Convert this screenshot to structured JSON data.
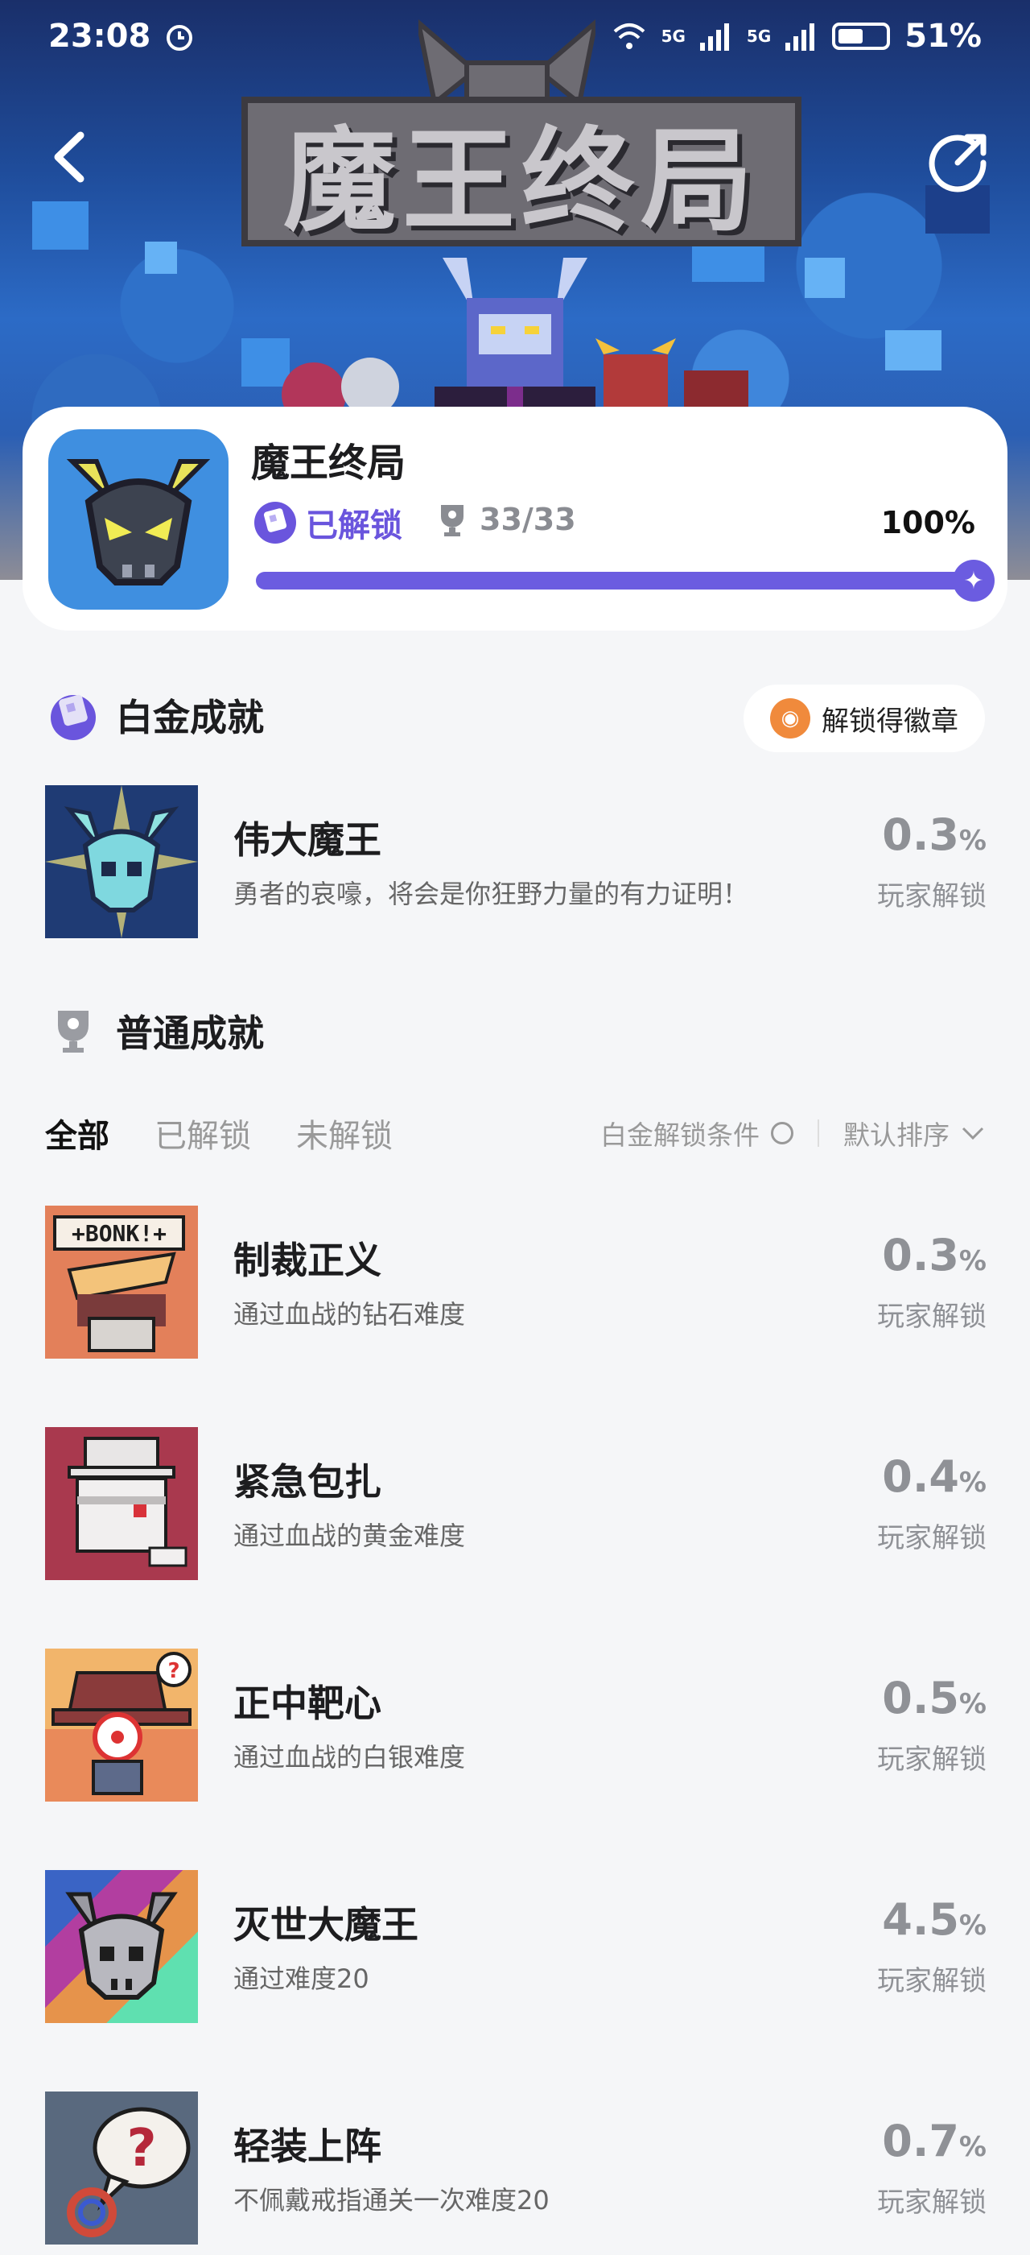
{
  "status_bar": {
    "time": "23:08",
    "battery": "51%",
    "network": "5G"
  },
  "banner": {
    "title_art": "魔王终局"
  },
  "game": {
    "name": "魔王终局",
    "unlock_status": "已解锁",
    "trophy_count": "33/33",
    "completion": "100%",
    "progress_fraction": 1.0
  },
  "platinum_section": {
    "title": "白金成就",
    "medal_button": "解锁得徽章"
  },
  "platinum": {
    "name": "伟大魔王",
    "desc": "勇者的哀嚎，将会是你狂野力量的有力证明！",
    "rate": "0.3",
    "rate_unit": "%",
    "rate_label": "玩家解锁"
  },
  "normal_section": {
    "title": "普通成就"
  },
  "filters": {
    "tabs": [
      "全部",
      "已解锁",
      "未解锁"
    ],
    "active_tab": "全部",
    "condition": "白金解锁条件",
    "sort": "默认排序"
  },
  "achievements": [
    {
      "name": "制裁正义",
      "desc": "通过血战的钻石难度",
      "rate": "0.3",
      "rate_unit": "%",
      "rate_label": "玩家解锁",
      "icon": "bonk-hammer-icon",
      "bg": "#e3805a"
    },
    {
      "name": "紧急包扎",
      "desc": "通过血战的黄金难度",
      "rate": "0.4",
      "rate_unit": "%",
      "rate_label": "玩家解锁",
      "icon": "bandaged-skull-icon",
      "bg": "#a9394e"
    },
    {
      "name": "正中靶心",
      "desc": "通过血战的白银难度",
      "rate": "0.5",
      "rate_unit": "%",
      "rate_label": "玩家解锁",
      "icon": "target-hat-icon",
      "bg": "#f2b56b"
    },
    {
      "name": "灭世大魔王",
      "desc": "通过难度20",
      "rate": "4.5",
      "rate_unit": "%",
      "rate_label": "玩家解锁",
      "icon": "demon-skull-icon",
      "bg": "#7b4bb0"
    },
    {
      "name": "轻装上阵",
      "desc": "不佩戴戒指通关一次难度20",
      "rate": "0.7",
      "rate_unit": "%",
      "rate_label": "玩家解锁",
      "icon": "ring-question-icon",
      "bg": "#59697e"
    }
  ]
}
